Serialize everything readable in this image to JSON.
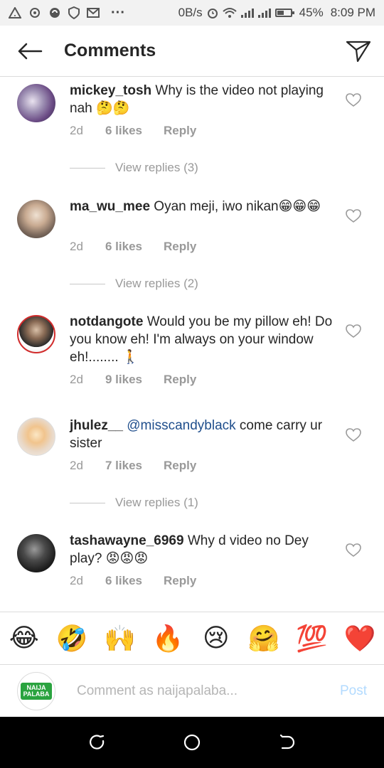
{
  "status_bar": {
    "left_icons": [
      "warning-icon",
      "chat-icon",
      "sync-icon",
      "shield-icon",
      "mail-icon",
      "more-icon"
    ],
    "more_glyph": "···",
    "net_speed": "0B/s",
    "battery": "45%",
    "time": "8:09 PM"
  },
  "header": {
    "title": "Comments"
  },
  "comments": [
    {
      "username": "mickey_tosh",
      "text": " Why is the video not playing nah 🤔🤔",
      "age": "2d",
      "likes": "6 likes",
      "reply": "Reply",
      "view_replies": "View replies (3)"
    },
    {
      "username": "ma_wu_mee",
      "text": " Oyan meji, iwo nikan😁😁😁",
      "age": "2d",
      "likes": "6 likes",
      "reply": "Reply",
      "view_replies": "View replies (2)"
    },
    {
      "username": "notdangote",
      "text": " Would you be my pillow eh! Do you know eh! I'm always on your window eh!........ 🚶",
      "age": "2d",
      "likes": "9 likes",
      "reply": "Reply",
      "view_replies": ""
    },
    {
      "username": "jhulez__",
      "mention": " @misscandyblack",
      "text": " come carry ur sister",
      "age": "2d",
      "likes": "7 likes",
      "reply": "Reply",
      "view_replies": "View replies (1)"
    },
    {
      "username": "tashawayne_6969",
      "text": " Why d video no Dey play? 😡😡😡",
      "age": "2d",
      "likes": "6 likes",
      "reply": "Reply",
      "view_replies": ""
    }
  ],
  "emoji_bar": {
    "emojis": [
      "😂",
      "🤣",
      "🙌",
      "🔥",
      "😢",
      "🤗",
      "💯",
      "❤️"
    ],
    "hundred_text": "100"
  },
  "composer": {
    "avatar_text_line1": "NAIJA",
    "avatar_text_line2": "PALABA",
    "placeholder": "Comment as naijapalaba...",
    "post_label": "Post"
  },
  "colors": {
    "accent_post_disabled": "#b3dbff",
    "mention": "#1f4e8c",
    "meta_gray": "#999999",
    "brand_green": "#2aa33f"
  }
}
